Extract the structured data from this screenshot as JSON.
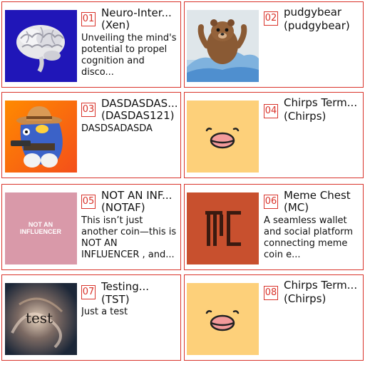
{
  "cards": [
    {
      "index": "01",
      "name": "Neuro-Inter...",
      "ticker": "(Xen)",
      "description": "Unveiling the mind's potential to propel cognition and disco...",
      "image": "brain-image"
    },
    {
      "index": "02",
      "name": "pudgybear",
      "ticker": "(pudgybear)",
      "description": "",
      "image": "bear-image"
    },
    {
      "index": "03",
      "name": "DASDASDAS...",
      "ticker": "(DASDAS121)",
      "description": "DASDSADASDA",
      "image": "cowboy-creature-image"
    },
    {
      "index": "04",
      "name": "Chirps Term...",
      "ticker": "(Chirps)",
      "description": "",
      "image": "chick-face-image"
    },
    {
      "index": "05",
      "name": "NOT AN INF...",
      "ticker": "(NOTAF)",
      "description": "This isn’t just another coin—this is NOT AN INFLUENCER , and...",
      "image": "not-an-influencer-image",
      "image_text": "NOT AN INFLUENCER"
    },
    {
      "index": "06",
      "name": "Meme Chest",
      "ticker": "(MC)",
      "description": "A seamless wallet and social platform connecting meme coin e...",
      "image": "mc-logo-image"
    },
    {
      "index": "07",
      "name": "Testing...",
      "ticker": "(TST)",
      "description": "Just a test",
      "image": "test-smoke-image",
      "image_text": "test"
    },
    {
      "index": "08",
      "name": "Chirps Term...",
      "ticker": "(Chirps)",
      "description": "",
      "image": "chick-face-image"
    }
  ],
  "colors": {
    "accent": "#d9342b",
    "brain_bg": "#2016b8",
    "chick_bg": "#fdd07a",
    "influencer_bg": "#d999a9",
    "mc_bg": "#c8502e"
  }
}
